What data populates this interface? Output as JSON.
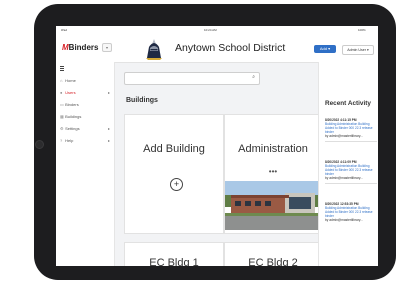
{
  "statusbar": {
    "carrier": "iPad",
    "time": "10:24 AM",
    "battery": "100%"
  },
  "brand": {
    "logo_mark": "M",
    "logo_text": "Binders",
    "accent_color": "#d62027",
    "link_color": "#2f6fc6"
  },
  "header": {
    "district": "Anytown School District",
    "add_label": "Add",
    "user_label": "Admin User"
  },
  "sidebar": {
    "items": [
      {
        "label": "Home",
        "icon": "home-icon",
        "glyph": "⌂",
        "active": false,
        "expand": ""
      },
      {
        "label": "Users",
        "icon": "user-icon",
        "glyph": "●",
        "active": true,
        "expand": "▸"
      },
      {
        "label": "Binders",
        "icon": "binder-icon",
        "glyph": "▭",
        "active": false,
        "expand": ""
      },
      {
        "label": "Buildings",
        "icon": "building-icon",
        "glyph": "▦",
        "active": false,
        "expand": ""
      },
      {
        "label": "Settings",
        "icon": "gear-icon",
        "glyph": "⚙",
        "active": false,
        "expand": "▸"
      },
      {
        "label": "Help",
        "icon": "help-icon",
        "glyph": "?",
        "active": false,
        "expand": "▸"
      }
    ]
  },
  "main": {
    "search_placeholder": "",
    "heading": "Buildings",
    "add_card": {
      "title": "Add Building",
      "icon": "plus-circle-icon"
    },
    "cards": [
      {
        "title": "Administration",
        "menu": "•••"
      },
      {
        "title": "EC Bldg 1"
      },
      {
        "title": "EC Bldg 2"
      }
    ]
  },
  "recent_activity": {
    "title": "Recent Activity",
    "entries": [
      {
        "time": "8/20/2022 4:11:15 PM",
        "text": "Building Administration Building Added to Binder 000 22.3 release binder",
        "by": "by admin@mastertlibrary..."
      },
      {
        "time": "8/20/2022 4:11:09 PM",
        "text": "Building Administration Building Added to Binder 000 22.3 release binder",
        "by": "by admin@mastertlibrary..."
      },
      {
        "time": "8/20/2022 12:53:35 PM",
        "text": "Building Administration Building Added to Binder 000 22.3 release binder",
        "by": "by admin@mastertlibrary..."
      }
    ]
  }
}
